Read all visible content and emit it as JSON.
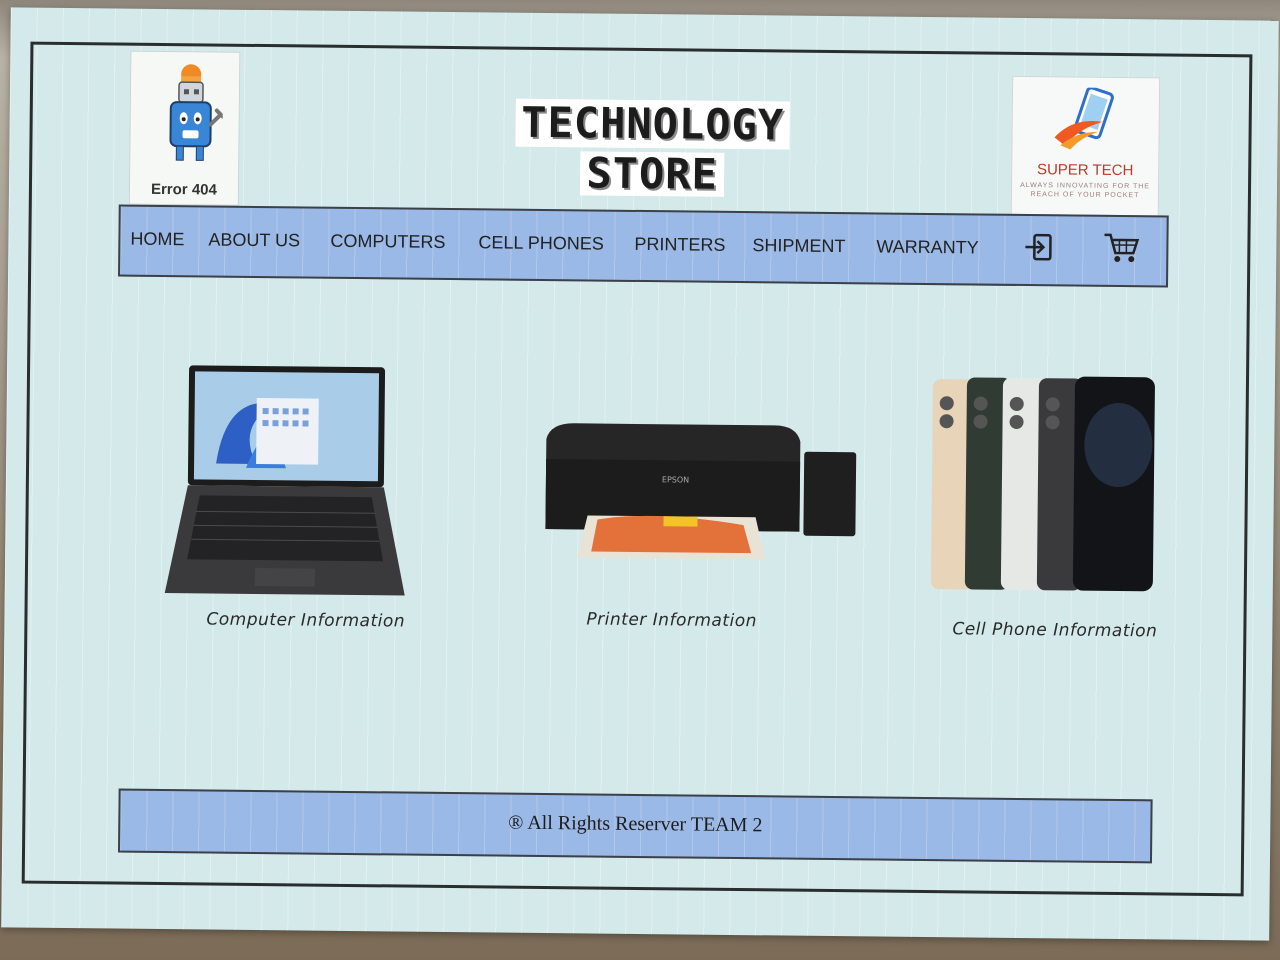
{
  "store": {
    "title_line1": "TECHNOLOGY",
    "title_line2": "STORE"
  },
  "left_logo": {
    "caption": "Error 404",
    "icon": "usb-robot-icon"
  },
  "right_logo": {
    "name": "SUPER TECH",
    "slogan": "ALWAYS INNOVATING FOR THE REACH OF YOUR POCKET",
    "icon": "smartphone-icon"
  },
  "nav": {
    "items": [
      {
        "label": "HOME"
      },
      {
        "label": "ABOUT US"
      },
      {
        "label": "COMPUTERS"
      },
      {
        "label": "CELL PHONES"
      },
      {
        "label": "PRINTERS"
      },
      {
        "label": "SHIPMENT"
      },
      {
        "label": "WARRANTY"
      }
    ],
    "login_icon": "login-icon",
    "cart_icon": "shopping-cart-icon"
  },
  "products": [
    {
      "caption": "Computer Information",
      "image": "laptop"
    },
    {
      "caption": "Printer Information",
      "image": "printer"
    },
    {
      "caption": "Cell Phone Information",
      "image": "cell-phones"
    }
  ],
  "footer": {
    "text": "® All Rights Reserver TEAM 2"
  },
  "colors": {
    "paper": "#d4e9ea",
    "bar": "#9bb9e6",
    "frame": "#2a2d2e",
    "brand_red": "#c0392b"
  }
}
